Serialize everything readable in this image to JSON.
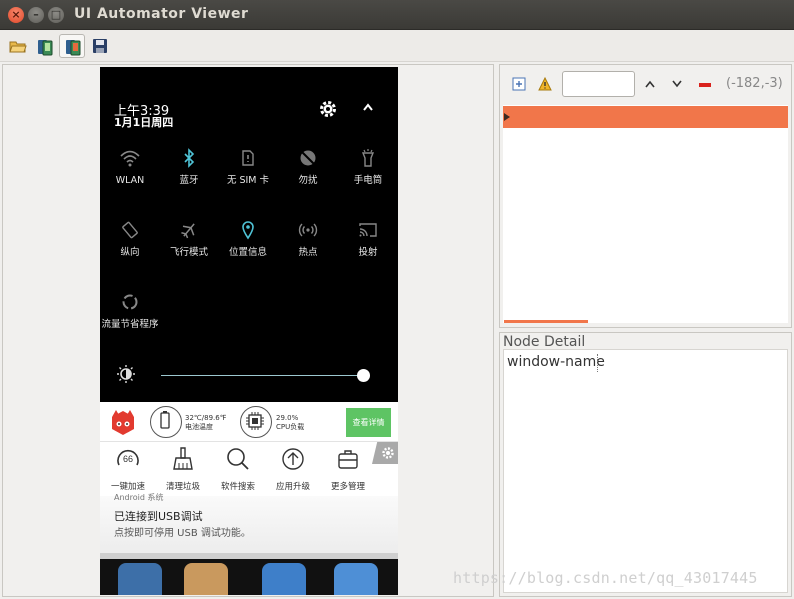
{
  "window": {
    "title": "UI Automator Viewer",
    "close_glyph": "×",
    "minimize_glyph": "–",
    "maximize_glyph": "□"
  },
  "toolbar": {
    "icons": [
      "open-folder-icon",
      "device-screenshot-icon",
      "device-screenshot-compressed-icon",
      "save-icon"
    ]
  },
  "phone": {
    "time": "上午3:39",
    "date": "1月1日周四",
    "quick_settings": [
      {
        "label": "WLAN",
        "icon": "wifi-icon"
      },
      {
        "label": "蓝牙",
        "icon": "bluetooth-icon"
      },
      {
        "label": "无 SIM 卡",
        "icon": "sim-card-icon"
      },
      {
        "label": "勿扰",
        "icon": "do-not-disturb-icon"
      },
      {
        "label": "手电筒",
        "icon": "flashlight-icon"
      },
      {
        "label": "纵向",
        "icon": "screen-rotation-icon"
      },
      {
        "label": "飞行模式",
        "icon": "airplane-mode-icon"
      },
      {
        "label": "位置信息",
        "icon": "location-icon"
      },
      {
        "label": "热点",
        "icon": "hotspot-icon"
      },
      {
        "label": "投射",
        "icon": "cast-icon"
      },
      {
        "label": "流量节省程序",
        "icon": "data-saver-icon"
      }
    ],
    "brightness_level": 1.0,
    "card": {
      "battery_temp": "32℃/89.6℉",
      "battery_label": "电池温度",
      "cpu_load": "29.0%",
      "cpu_label": "CPU负载",
      "details_button": "查看详情"
    },
    "tools": [
      {
        "label": "一键加速",
        "icon": "speedup-icon",
        "value": "66"
      },
      {
        "label": "清理垃圾",
        "icon": "broom-icon"
      },
      {
        "label": "软件搜索",
        "icon": "search-icon"
      },
      {
        "label": "应用升级",
        "icon": "upgrade-icon"
      },
      {
        "label": "更多管理",
        "icon": "toolbox-icon"
      }
    ],
    "notification": {
      "app": "Android 系统",
      "title": "已连接到USB调试",
      "subtitle": "点按即可停用 USB 调试功能。"
    }
  },
  "hierarchy": {
    "coords": "(-182,-3)",
    "search_value": "",
    "icons": [
      "expand-all-icon",
      "warning-icon",
      "previous-icon",
      "next-icon",
      "clear-icon"
    ]
  },
  "node_detail": {
    "label": "Node Detail",
    "row_key": "window-name",
    "row_value": ""
  },
  "watermark": "https://blog.csdn.net/qq_43017445"
}
